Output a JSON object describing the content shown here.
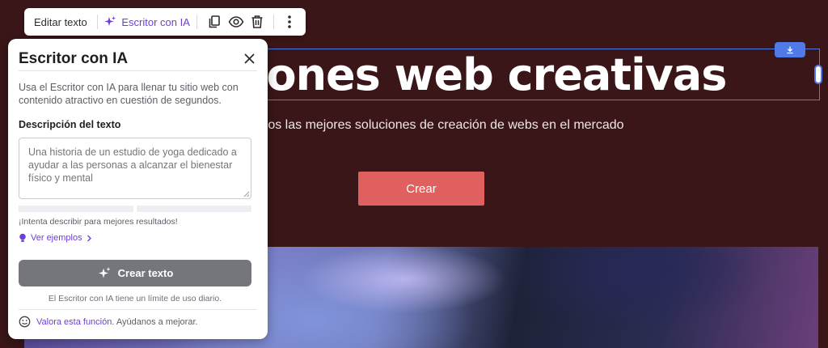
{
  "toolbar": {
    "edit_label": "Editar texto",
    "ai_label": "Escritor con IA",
    "icons": [
      "sparkle-icon",
      "duplicate-icon",
      "eye-icon",
      "trash-icon",
      "more-vertical-icon"
    ]
  },
  "hero": {
    "title": "iones web creativas",
    "subtitle": "mos las mejores soluciones de creación de webs en el mercado",
    "cta_label": "Crear"
  },
  "panel": {
    "title": "Escritor con IA",
    "description": "Usa el Escritor con IA para llenar tu sitio web con contenido atractivo en cuestión de segundos.",
    "field_label": "Descripción del texto",
    "placeholder": "Una historia de un estudio de yoga dedicado a ayudar a las personas a alcanzar el bienestar físico y mental",
    "hint": "¡Intenta describir para mejores resultados!",
    "examples_label": "Ver ejemplos",
    "create_label": "Crear texto",
    "limit_note": "El Escritor con IA tiene un límite de uso diario.",
    "feedback_link": "Valora esta función",
    "feedback_rest": ". Ayúdanos a mejorar."
  },
  "colors": {
    "background": "#3a1618",
    "accent": "#6c3fd6",
    "cta": "#e05f5f",
    "selection": "#4f7ae8",
    "button_disabled": "#75767c"
  }
}
